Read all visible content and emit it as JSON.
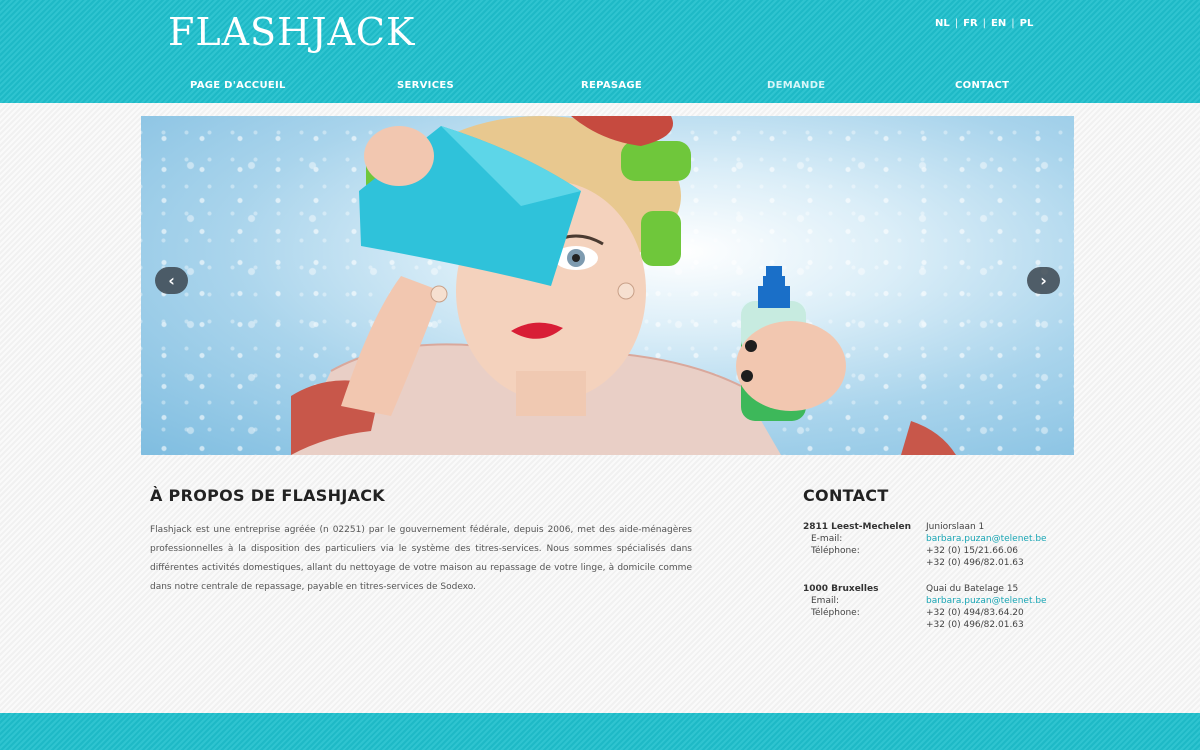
{
  "brand": {
    "logo_text": "FLASHJACK",
    "accent": "#1fbfcc",
    "link_color": "#1aa6b5"
  },
  "languages": [
    "NL",
    "FR",
    "EN",
    "PL"
  ],
  "nav": {
    "items": [
      {
        "label": "PAGE D'ACCUEIL"
      },
      {
        "label": "SERVICES"
      },
      {
        "label": "REPASAGE"
      },
      {
        "label": "DEMANDE"
      },
      {
        "label": "CONTACT"
      }
    ],
    "active_label": "DEMANDE"
  },
  "slider": {
    "prev_icon": "chevron-left-icon",
    "next_icon": "chevron-right-icon",
    "prev_glyph": "‹",
    "next_glyph": "›"
  },
  "about": {
    "title": "À PROPOS DE FLASHJACK",
    "text": "Flashjack est une entreprise agréée (n 02251) par le gouvernement fédérale, depuis 2006, met des aide-ménagères professionnelles à la disposition des particuliers via le système des titres-services. Nous sommes spécialisés dans différentes activités domestiques, allant du nettoyage de votre maison au repassage de votre linge, à domicile comme dans notre centrale de repassage, payable en titres-services de Sodexo."
  },
  "contact": {
    "title": "CONTACT",
    "offices": [
      {
        "city": "2811 Leest-Mechelen",
        "address": "Juniorslaan 1",
        "email_label": "E-mail:",
        "email": "barbara.puzan@telenet.be",
        "phone_label": "Téléphone:",
        "phones": [
          "+32 (0) 15/21.66.06",
          "+32 (0) 496/82.01.63"
        ]
      },
      {
        "city": "1000 Bruxelles",
        "address": "Quai du Batelage 15",
        "email_label": "Email:",
        "email": "barbara.puzan@telenet.be",
        "phone_label": "Téléphone:",
        "phones": [
          "+32 (0) 494/83.64.20",
          "+32 (0) 496/82.01.63"
        ]
      }
    ]
  }
}
